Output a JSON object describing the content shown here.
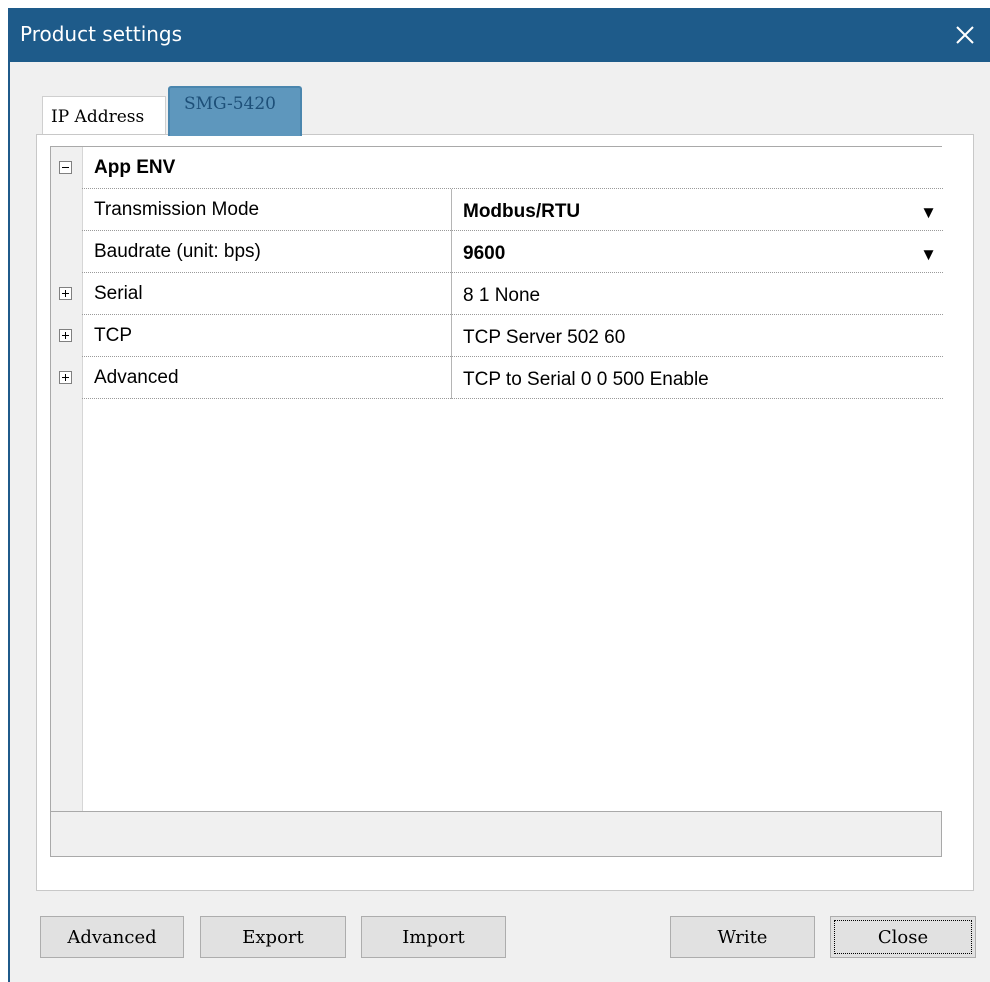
{
  "window": {
    "title": "Product settings"
  },
  "tabs": [
    {
      "label": "IP Address",
      "active": false
    },
    {
      "label": "SMG-5420",
      "active": true
    }
  ],
  "properties": {
    "group": {
      "label": "App ENV",
      "expanded": true
    },
    "rows": [
      {
        "name": "Transmission Mode",
        "value": "Modbus/RTU",
        "bold_value": true,
        "dropdown": true
      },
      {
        "name": "Baudrate (unit: bps)",
        "value": "9600",
        "bold_value": true,
        "dropdown": true
      },
      {
        "name": "Serial",
        "value": "8 1 None",
        "expandable": true
      },
      {
        "name": "TCP",
        "value": "TCP Server  502 60",
        "expandable": true
      },
      {
        "name": "Advanced",
        "value": "TCP to Serial 0 0 500 Enable",
        "expandable": true
      }
    ]
  },
  "icons": {
    "close": "close-icon",
    "dropdown": "▼",
    "collapse": "minus-box-icon",
    "expand": "plus-box-icon"
  },
  "buttons": {
    "advanced": "Advanced",
    "export": "Export",
    "import": "Import",
    "write": "Write",
    "close": "Close"
  },
  "colors": {
    "titlebar": "#1e5b8a",
    "active_tab": "#5e97bd",
    "active_tab_text": "#1d4f78"
  }
}
